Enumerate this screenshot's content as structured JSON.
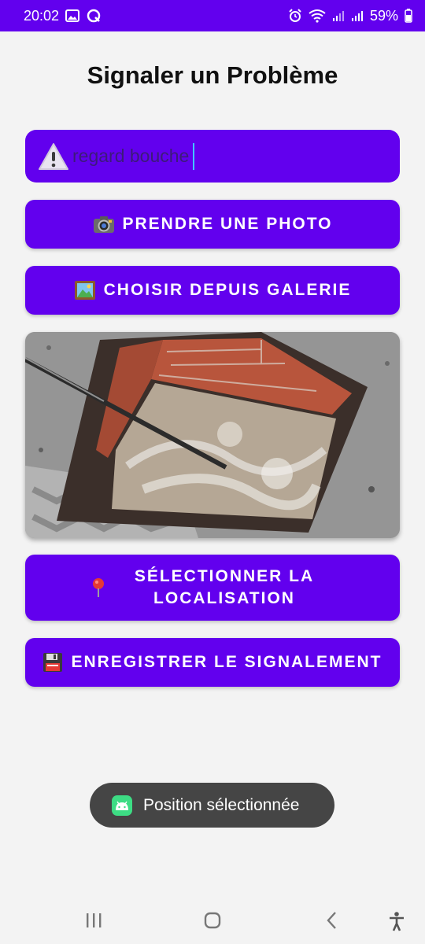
{
  "status_bar": {
    "time": "20:02",
    "battery": "59%",
    "icons": [
      "gallery-icon",
      "q-app-icon",
      "alarm-icon",
      "wifi-icon",
      "signal-icon",
      "signal-icon",
      "battery-icon"
    ]
  },
  "page": {
    "title": "Signaler un Problème"
  },
  "description_input": {
    "value": "regard bouche",
    "icon": "warning-icon"
  },
  "buttons": {
    "take_photo": "PRENDRE UNE PHOTO",
    "choose_gallery": "CHOISIR DEPUIS GALERIE",
    "select_location": "SÉLECTIONNER LA LOCALISATION",
    "save_report": "ENREGISTRER LE SIGNALEMENT"
  },
  "button_icons": {
    "take_photo": "camera-icon",
    "choose_gallery": "picture-icon",
    "select_location": "pin-icon",
    "save_report": "floppy-disk-icon"
  },
  "toast": {
    "message": "Position sélectionnée",
    "icon": "android-icon"
  },
  "nav_bar": {
    "icons": [
      "recent-apps-icon",
      "home-icon",
      "back-icon",
      "accessibility-icon"
    ]
  },
  "colors": {
    "primary": "#6200ee",
    "background": "#f3f3f3",
    "toast_bg": "#454545"
  }
}
